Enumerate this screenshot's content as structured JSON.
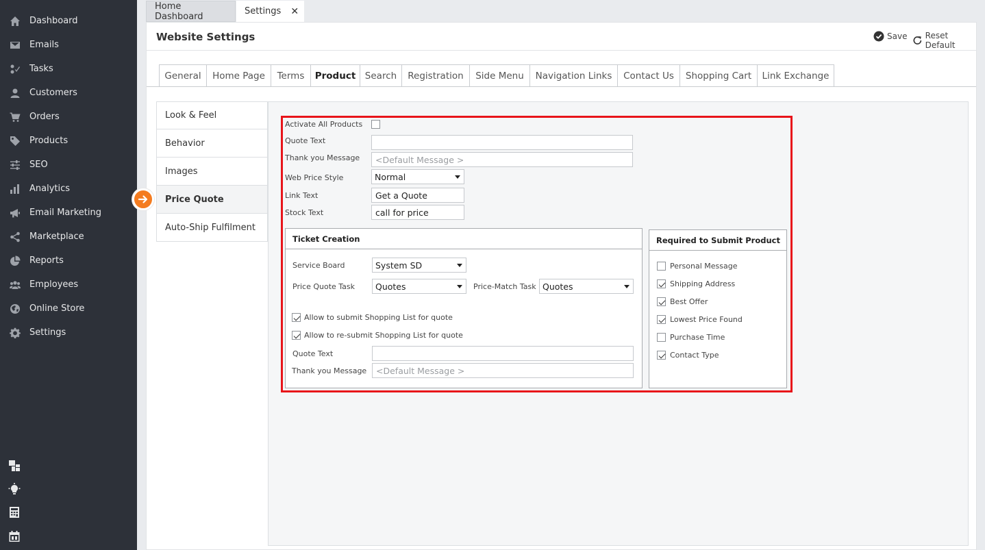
{
  "sidebar": {
    "items": [
      {
        "label": "Dashboard",
        "icon": "home-icon"
      },
      {
        "label": "Emails",
        "icon": "envelope-icon"
      },
      {
        "label": "Tasks",
        "icon": "tasks-icon"
      },
      {
        "label": "Customers",
        "icon": "user-icon"
      },
      {
        "label": "Orders",
        "icon": "cart-icon"
      },
      {
        "label": "Products",
        "icon": "tag-icon"
      },
      {
        "label": "SEO",
        "icon": "sliders-icon"
      },
      {
        "label": "Analytics",
        "icon": "bar-chart-icon"
      },
      {
        "label": "Email Marketing",
        "icon": "megaphone-icon"
      },
      {
        "label": "Marketplace",
        "icon": "share-icon"
      },
      {
        "label": "Reports",
        "icon": "pie-chart-icon"
      },
      {
        "label": "Employees",
        "icon": "users-icon"
      },
      {
        "label": "Online Store",
        "icon": "globe-icon"
      },
      {
        "label": "Settings",
        "icon": "gear-icon"
      }
    ],
    "bottom_icons": [
      "windows-icon",
      "lightbulb-icon",
      "calculator-icon",
      "calendar-icon"
    ]
  },
  "doc_tabs": [
    {
      "label": "Home Dashboard"
    },
    {
      "label": "Settings"
    }
  ],
  "header": {
    "title": "Website Settings",
    "save_label": "Save",
    "reset_label": "Reset Default"
  },
  "tabs": [
    {
      "label": "General"
    },
    {
      "label": "Home Page"
    },
    {
      "label": "Terms"
    },
    {
      "label": "Product"
    },
    {
      "label": "Search"
    },
    {
      "label": "Registration"
    },
    {
      "label": "Side Menu"
    },
    {
      "label": "Navigation Links"
    },
    {
      "label": "Contact Us"
    },
    {
      "label": "Shopping Cart"
    },
    {
      "label": "Link Exchange"
    }
  ],
  "submenu": [
    {
      "label": "Look & Feel"
    },
    {
      "label": "Behavior"
    },
    {
      "label": "Images"
    },
    {
      "label": "Price Quote"
    },
    {
      "label": "Auto-Ship Fulfilment"
    }
  ],
  "form": {
    "activate_label": "Activate All Products",
    "quote_text_label": "Quote Text",
    "quote_text_value": "",
    "thank_you_label": "Thank you Message",
    "thank_you_placeholder": "<Default Message >",
    "web_price_label": "Web Price Style",
    "web_price_value": "Normal",
    "link_text_label": "Link Text",
    "link_text_value": "Get a Quote",
    "stock_text_label": "Stock Text",
    "stock_text_value": "call for price"
  },
  "ticket": {
    "title": "Ticket Creation",
    "service_board_label": "Service Board",
    "service_board_value": "System SD",
    "price_quote_task_label": "Price Quote Task",
    "price_quote_task_value": "Quotes",
    "price_match_task_label": "Price-Match Task",
    "price_match_task_value": "Quotes",
    "allow_submit_label": "Allow to submit Shopping List  for quote",
    "allow_resubmit_label": "Allow to re-submit Shopping List  for quote",
    "quote_text_label": "Quote Text",
    "quote_text_value": "",
    "thank_you_label": "Thank you Message",
    "thank_you_placeholder": "<Default Message >"
  },
  "required": {
    "title": "Required to Submit Product",
    "items": [
      {
        "label": "Personal Message",
        "checked": false
      },
      {
        "label": "Shipping Address",
        "checked": true
      },
      {
        "label": "Best Offer",
        "checked": true
      },
      {
        "label": "Lowest Price Found",
        "checked": true
      },
      {
        "label": "Purchase Time",
        "checked": false
      },
      {
        "label": "Contact Type",
        "checked": true
      }
    ]
  },
  "colors": {
    "sidebar_bg": "#2d3139",
    "highlight_frame": "#e8141a",
    "arrow_badge": "#f47c20"
  }
}
